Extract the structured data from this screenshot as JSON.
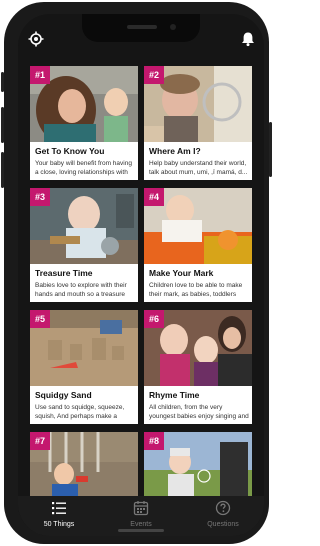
{
  "colors": {
    "badge": "#c4186e",
    "screen_bg": "#151515",
    "nav_bg": "#1c1c1c"
  },
  "header": {
    "left_icon": "location-icon",
    "right_icon": "bell-icon"
  },
  "cards": [
    {
      "badge": "#1",
      "title": "Get To Know You",
      "desc": "Your baby will benefit from having a close, loving relationships with t..."
    },
    {
      "badge": "#2",
      "title": "Where Am I?",
      "desc": "Help baby understand their world, talk about mum, umi, ,ï mamá, d..."
    },
    {
      "badge": "#3",
      "title": "Treasure Time",
      "desc": "Babies love to explore with their hands and mouth so a treasure ba..."
    },
    {
      "badge": "#4",
      "title": "Make Your Mark",
      "desc": "Children love to be able to make their mark, as babies, toddlers and..."
    },
    {
      "badge": "#5",
      "title": "Squidgy Sand",
      "desc": "Use sand to squidge, squeeze, squish, And perhaps make a sand..."
    },
    {
      "badge": "#6",
      "title": "Rhyme Time",
      "desc": "All children, from the very youngest babies enjoy singing and rhymes. ..."
    },
    {
      "badge": "#7",
      "title": "",
      "desc": ""
    },
    {
      "badge": "#8",
      "title": "",
      "desc": ""
    }
  ],
  "nav": [
    {
      "label": "50 Things",
      "icon": "list-icon"
    },
    {
      "label": "Events",
      "icon": "calendar-icon"
    },
    {
      "label": "Questions",
      "icon": "help-icon"
    }
  ]
}
